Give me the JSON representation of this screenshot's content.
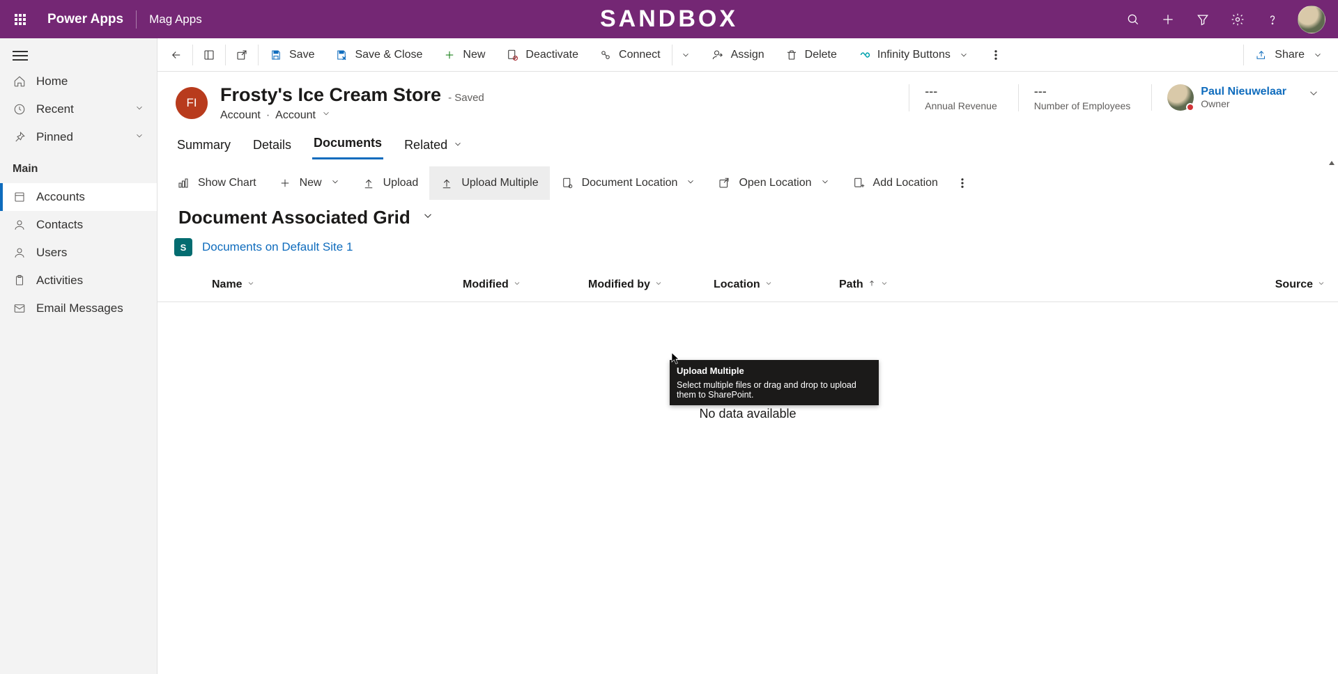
{
  "top_bar": {
    "app_title": "Power Apps",
    "app_subtitle": "Mag Apps",
    "env_banner": "SANDBOX"
  },
  "left_nav": {
    "home": "Home",
    "recent": "Recent",
    "pinned": "Pinned",
    "section_main": "Main",
    "accounts": "Accounts",
    "contacts": "Contacts",
    "users": "Users",
    "activities": "Activities",
    "email": "Email Messages"
  },
  "cmd_bar": {
    "save": "Save",
    "save_close": "Save & Close",
    "new": "New",
    "deactivate": "Deactivate",
    "connect": "Connect",
    "assign": "Assign",
    "delete": "Delete",
    "infinity": "Infinity Buttons",
    "share": "Share"
  },
  "record": {
    "initials": "FI",
    "name": "Frosty's Ice Cream Store",
    "saved": "- Saved",
    "entity": "Account",
    "form": "Account"
  },
  "stats": {
    "annual_revenue_val": "---",
    "annual_revenue_label": "Annual Revenue",
    "employees_val": "---",
    "employees_label": "Number of Employees"
  },
  "owner": {
    "name": "Paul Nieuwelaar",
    "label": "Owner"
  },
  "tabs": {
    "summary": "Summary",
    "details": "Details",
    "documents": "Documents",
    "related": "Related"
  },
  "subgrid_cmd": {
    "show_chart": "Show Chart",
    "new": "New",
    "upload": "Upload",
    "upload_multiple": "Upload Multiple",
    "doc_location": "Document Location",
    "open_location": "Open Location",
    "add_location": "Add Location"
  },
  "subgrid": {
    "title": "Document Associated Grid",
    "sp_link": "Documents on Default Site 1",
    "no_data": "No data available"
  },
  "columns": {
    "name": "Name",
    "modified": "Modified",
    "modified_by": "Modified by",
    "location": "Location",
    "path": "Path",
    "source": "Source"
  },
  "tooltip": {
    "title": "Upload Multiple",
    "body": "Select multiple files or drag and drop to upload them to SharePoint."
  }
}
